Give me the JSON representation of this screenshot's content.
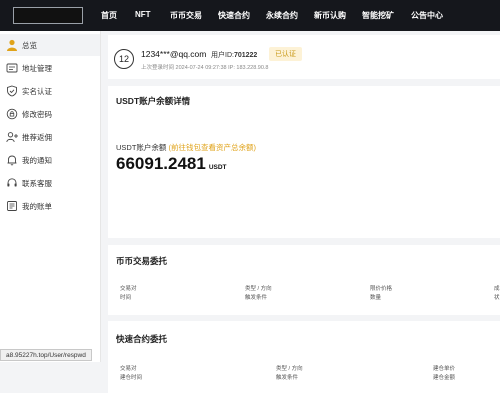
{
  "nav": [
    "首页",
    "NFT",
    "币币交易",
    "快速合约",
    "永续合约",
    "新币认购",
    "智能挖矿",
    "公告中心"
  ],
  "sidebar": [
    {
      "label": "总览",
      "icon": "user-icon"
    },
    {
      "label": "地址管理",
      "icon": "address-card-icon"
    },
    {
      "label": "实名认证",
      "icon": "shield-check-icon"
    },
    {
      "label": "修改密码",
      "icon": "lock-icon"
    },
    {
      "label": "推荐返佣",
      "icon": "user-plus-icon"
    },
    {
      "label": "我的通知",
      "icon": "bell-icon"
    },
    {
      "label": "联系客服",
      "icon": "headset-icon"
    },
    {
      "label": "我的账单",
      "icon": "bill-icon"
    }
  ],
  "profile": {
    "avatar": "12",
    "email": "1234***@qq.com",
    "uid_label": "用户ID:",
    "uid": "701222",
    "badge": "已认证",
    "login": "上次登录时间 2024-07-24 09:27:38  IP: 183.228.90.8"
  },
  "balance": {
    "title": "USDT账户余额详情",
    "label": "USDT账户余额",
    "link": "(前往钱包查看资产总余额)",
    "value": "66091.2481",
    "unit": "USDT"
  },
  "spot": {
    "title": "币币交易委托",
    "headers": [
      [
        "交易对",
        "时间"
      ],
      [
        "类型 / 方向",
        "触发条件"
      ],
      [
        "限价价格",
        "数量"
      ],
      [
        "成",
        "状"
      ]
    ]
  },
  "futures": {
    "title": "快速合约委托",
    "headers": [
      [
        "交易对",
        "建仓时间"
      ],
      [
        "类型 / 方向",
        "触发条件"
      ],
      [
        "建仓单价",
        "建仓金额"
      ]
    ]
  },
  "status_url": "a8.95227h.top/User/respwd"
}
